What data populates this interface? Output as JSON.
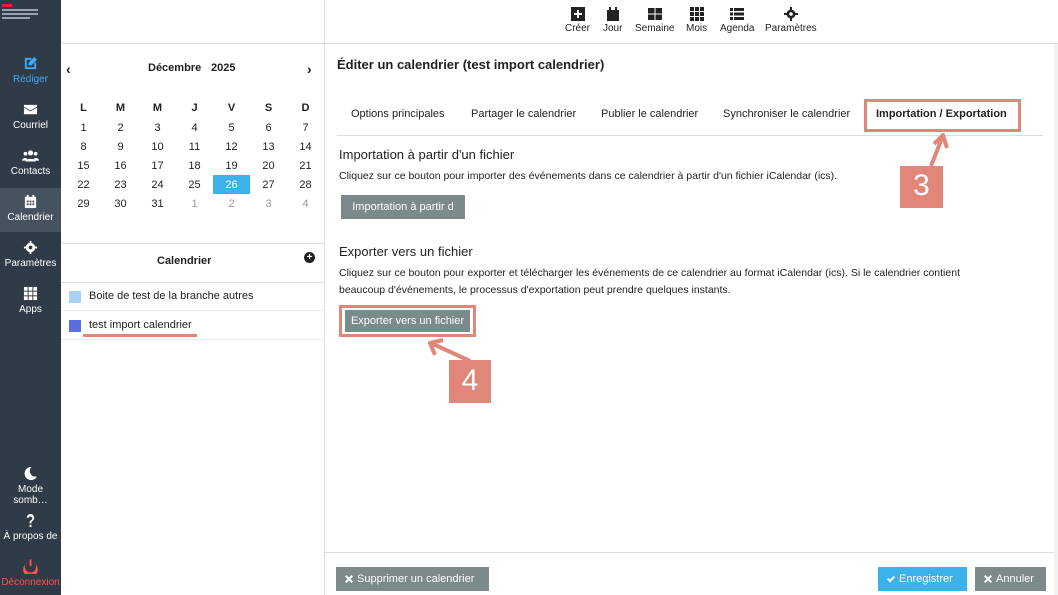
{
  "rail": {
    "items": [
      {
        "label": "Rédiger",
        "icon": "edit-icon"
      },
      {
        "label": "Courriel",
        "icon": "mail-icon"
      },
      {
        "label": "Contacts",
        "icon": "users-icon"
      },
      {
        "label": "Calendrier",
        "icon": "calendar-icon"
      },
      {
        "label": "Paramètres",
        "icon": "gear-icon"
      },
      {
        "label": "Apps",
        "icon": "grid-icon"
      }
    ],
    "bottom": [
      {
        "label": "Mode somb…",
        "icon": "moon-icon"
      },
      {
        "label": "À propos de",
        "icon": "question-icon"
      },
      {
        "label": "Déconnexion",
        "icon": "power-icon"
      }
    ]
  },
  "toolbar": {
    "items": [
      {
        "label": "Créer",
        "icon": "plus-square-icon"
      },
      {
        "label": "Jour",
        "icon": "calendar-day-icon"
      },
      {
        "label": "Semaine",
        "icon": "week-icon"
      },
      {
        "label": "Mois",
        "icon": "month-icon"
      },
      {
        "label": "Agenda",
        "icon": "list-icon"
      },
      {
        "label": "Paramètres",
        "icon": "gear-icon"
      }
    ]
  },
  "minical": {
    "month": "Décembre",
    "year": "2025",
    "days": [
      "L",
      "M",
      "M",
      "J",
      "V",
      "S",
      "D"
    ],
    "weeks": [
      [
        "1",
        "2",
        "3",
        "4",
        "5",
        "6",
        "7"
      ],
      [
        "8",
        "9",
        "10",
        "11",
        "12",
        "13",
        "14"
      ],
      [
        "15",
        "16",
        "17",
        "18",
        "19",
        "20",
        "21"
      ],
      [
        "22",
        "23",
        "24",
        "25",
        "26",
        "27",
        "28"
      ],
      [
        "29",
        "30",
        "31",
        "1",
        "2",
        "3",
        "4"
      ]
    ],
    "today": "26"
  },
  "calendars": {
    "heading": "Calendrier",
    "items": [
      {
        "name": "Boite de test de la branche autres",
        "color": "#a9d0f5"
      },
      {
        "name": "test import calendrier",
        "color": "#5b6ee1"
      }
    ]
  },
  "main": {
    "title": "Éditer un calendrier (test import calendrier)",
    "tabs": [
      "Options principales",
      "Partager le calendrier",
      "Publier le calendrier",
      "Synchroniser le calendrier",
      "Importation / Exportation"
    ],
    "import": {
      "heading": "Importation à partir d'un fichier",
      "text": "Cliquez sur ce bouton pour importer des événements dans ce calendrier à partir d'un fichier iCalendar (ics).",
      "button": "Importation à partir d"
    },
    "export": {
      "heading": "Exporter vers un fichier",
      "text1": "Cliquez sur ce bouton pour exporter et télécharger les événements de ce calendrier au format iCalendar (ics). Si le calendrier contient",
      "text2": "beaucoup d'événements, le processus d'exportation peut prendre quelques instants.",
      "button": "Exporter vers un fichier"
    },
    "badges": [
      "3",
      "4"
    ]
  },
  "footer": {
    "delete": "Supprimer un calendrier",
    "save": "Enregistrer",
    "cancel": "Annuler"
  },
  "colors": {
    "accent": "#3bb3e8",
    "highlight": "#e0877a",
    "rail": "#2f3b46",
    "button": "#7b8a8b"
  }
}
